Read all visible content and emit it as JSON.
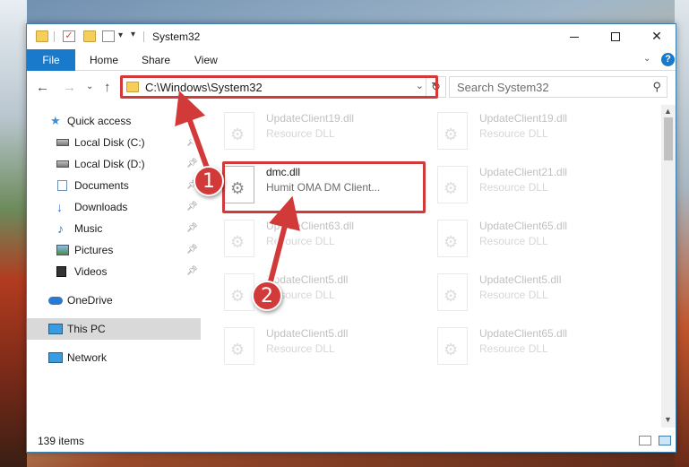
{
  "window": {
    "title": "System32",
    "controls": {
      "minimize": "—",
      "maximize": "☐",
      "close": "✕"
    }
  },
  "ribbon": {
    "file_tab": "File",
    "tabs": [
      "Home",
      "Share",
      "View"
    ],
    "help": "?"
  },
  "address": {
    "path": "C:\\Windows\\System32",
    "search_placeholder": "Search System32"
  },
  "sidebar": {
    "items": [
      {
        "label": "Quick access",
        "icon": "star-icon"
      },
      {
        "label": "Local Disk (C:)",
        "icon": "disk-icon",
        "pinned": true
      },
      {
        "label": "Local Disk (D:)",
        "icon": "disk-icon",
        "pinned": true
      },
      {
        "label": "Documents",
        "icon": "documents-icon",
        "pinned": true
      },
      {
        "label": "Downloads",
        "icon": "downloads-icon",
        "pinned": true
      },
      {
        "label": "Music",
        "icon": "music-icon",
        "pinned": true
      },
      {
        "label": "Pictures",
        "icon": "pictures-icon",
        "pinned": true
      },
      {
        "label": "Videos",
        "icon": "videos-icon",
        "pinned": true
      },
      {
        "label": "OneDrive",
        "icon": "onedrive-icon"
      },
      {
        "label": "This PC",
        "icon": "this-pc-icon",
        "selected": true
      },
      {
        "label": "Network",
        "icon": "network-icon"
      }
    ]
  },
  "files": {
    "left": [
      {
        "name": "UpdateClient19.dll",
        "desc": "Resource DLL"
      },
      {
        "name": "dmc.dll",
        "desc": "Humit OMA DM Client..."
      },
      {
        "name": "UpdateClient63.dll",
        "desc": "Resource DLL"
      },
      {
        "name": "UpdateClient5.dll",
        "desc": "Resource DLL"
      },
      {
        "name": "UpdateClient5.dll",
        "desc": "Resource DLL"
      }
    ],
    "right": [
      {
        "name": "UpdateClient19.dll",
        "desc": "Resource DLL"
      },
      {
        "name": "UpdateClient21.dll",
        "desc": "Resource DLL"
      },
      {
        "name": "UpdateClient65.dll",
        "desc": "Resource DLL"
      },
      {
        "name": "UpdateClient5.dll",
        "desc": "Resource DLL"
      },
      {
        "name": "UpdateClient65.dll",
        "desc": "Resource DLL"
      }
    ]
  },
  "status": {
    "item_count": "139 items"
  },
  "annotations": {
    "step1": "1",
    "step2": "2",
    "color": "#d23a3a"
  }
}
